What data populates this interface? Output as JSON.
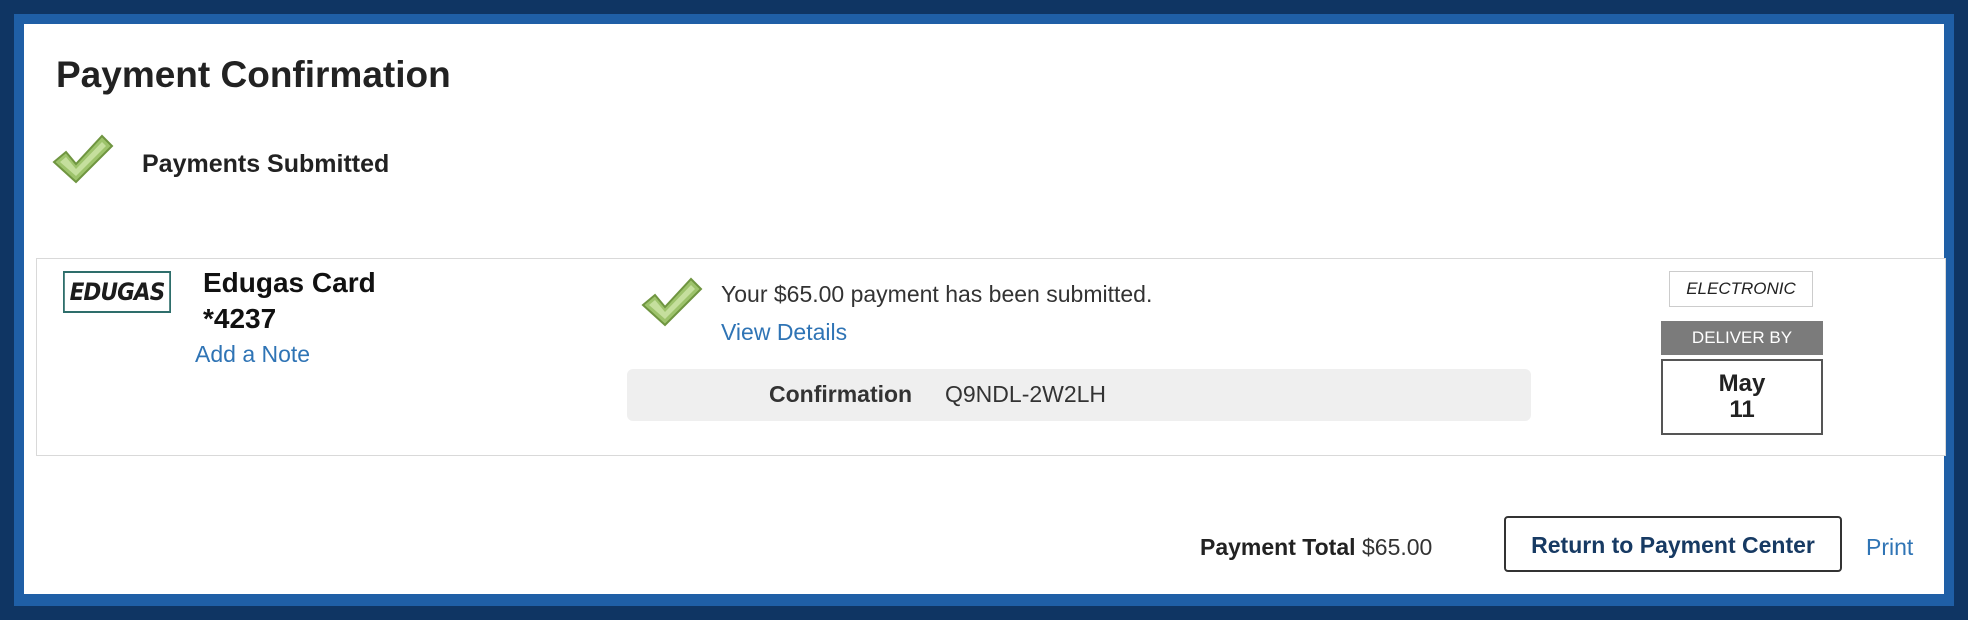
{
  "page": {
    "title": "Payment Confirmation",
    "status_label": "Payments Submitted"
  },
  "payment": {
    "payee_logo_text": "EDUGAS",
    "payee_name": "Edugas Card",
    "payee_account": "*4237",
    "add_note_label": "Add a Note",
    "message": "Your $65.00 payment has been submitted.",
    "view_details_label": "View Details",
    "confirmation_label": "Confirmation",
    "confirmation_number": "Q9NDL-2W2LH",
    "method": "ELECTRONIC",
    "deliver_by_label": "DELIVER BY",
    "deliver_month": "May",
    "deliver_day": "11"
  },
  "footer": {
    "total_label": "Payment Total",
    "total_value": "$65.00",
    "return_button_label": "Return to Payment Center",
    "print_label": "Print"
  },
  "icons": {
    "status": "checkmark-icon",
    "payment_status": "checkmark-icon"
  },
  "colors": {
    "background": "#0f3563",
    "frame": "#1f5fa6",
    "link": "#2f74b5",
    "check": "#9dc36b",
    "deliver_header": "#7b7b7b"
  }
}
